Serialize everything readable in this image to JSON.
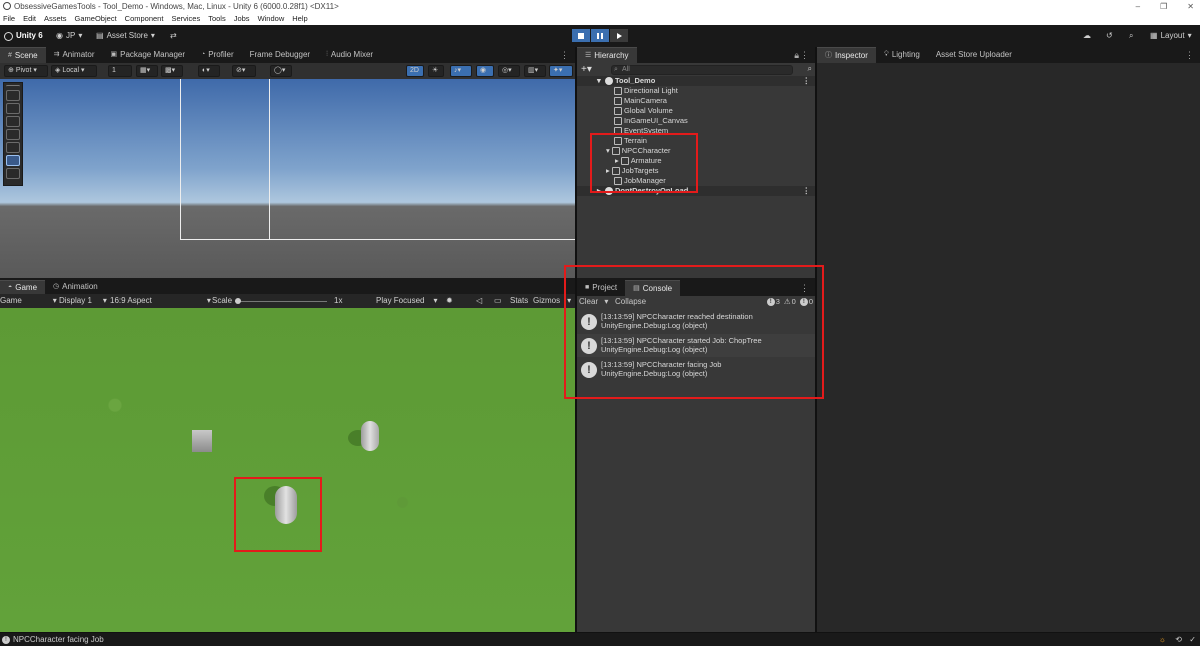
{
  "window": {
    "title": "ObsessiveGamesTools - Tool_Demo - Windows, Mac, Linux - Unity 6 (6000.0.28f1) <DX11>"
  },
  "menu": [
    "File",
    "Edit",
    "Assets",
    "GameObject",
    "Component",
    "Services",
    "Tools",
    "Jobs",
    "Window",
    "Help"
  ],
  "toolbar": {
    "unity_label": "Unity 6",
    "account": "JP",
    "asset_store": "Asset Store",
    "layout": "Layout"
  },
  "left_tabs": [
    "Scene",
    "Animator",
    "Package Manager",
    "Profiler",
    "Frame Debugger",
    "Audio Mixer"
  ],
  "scene_toolbar": {
    "pivot": "Pivot",
    "local": "Local",
    "grid_value": "1",
    "mode_2d": "2D"
  },
  "game_tabs": [
    "Game",
    "Animation"
  ],
  "game_toolbar": {
    "view": "Game",
    "display": "Display 1",
    "aspect": "16:9 Aspect",
    "scale_label": "Scale",
    "scale_value": "1x",
    "play_mode": "Play Focused",
    "stats": "Stats",
    "gizmos": "Gizmos"
  },
  "hierarchy": {
    "tab": "Hierarchy",
    "search_placeholder": "All",
    "scene_name": "Tool_Demo",
    "items": [
      "Directional Light",
      "MainCamera",
      "Global Volume",
      "InGameUI_Canvas",
      "EventSystem",
      "Terrain",
      "NPCCharacter",
      "Armature",
      "JobTargets",
      "JobManager"
    ],
    "dont_destroy": "DontDestroyOnLoad"
  },
  "right_tabs": [
    "Inspector",
    "Lighting",
    "Asset Store Uploader"
  ],
  "console": {
    "tabs": [
      "Project",
      "Console"
    ],
    "clear": "Clear",
    "collapse": "Collapse",
    "counts": {
      "info": "3",
      "warn": "0",
      "error": "0"
    },
    "entries": [
      {
        "line1": "[13:13:59] NPCCharacter reached destination",
        "line2": "UnityEngine.Debug:Log (object)"
      },
      {
        "line1": "[13:13:59] NPCCharacter started Job: ChopTree",
        "line2": "UnityEngine.Debug:Log (object)"
      },
      {
        "line1": "[13:13:59] NPCCharacter facing Job",
        "line2": "UnityEngine.Debug:Log (object)"
      }
    ]
  },
  "status": {
    "message": "NPCCharacter facing Job"
  },
  "colors": {
    "highlight": "#e31b1b",
    "play_active": "#3b6fb0",
    "grass": "#5d9a35"
  }
}
